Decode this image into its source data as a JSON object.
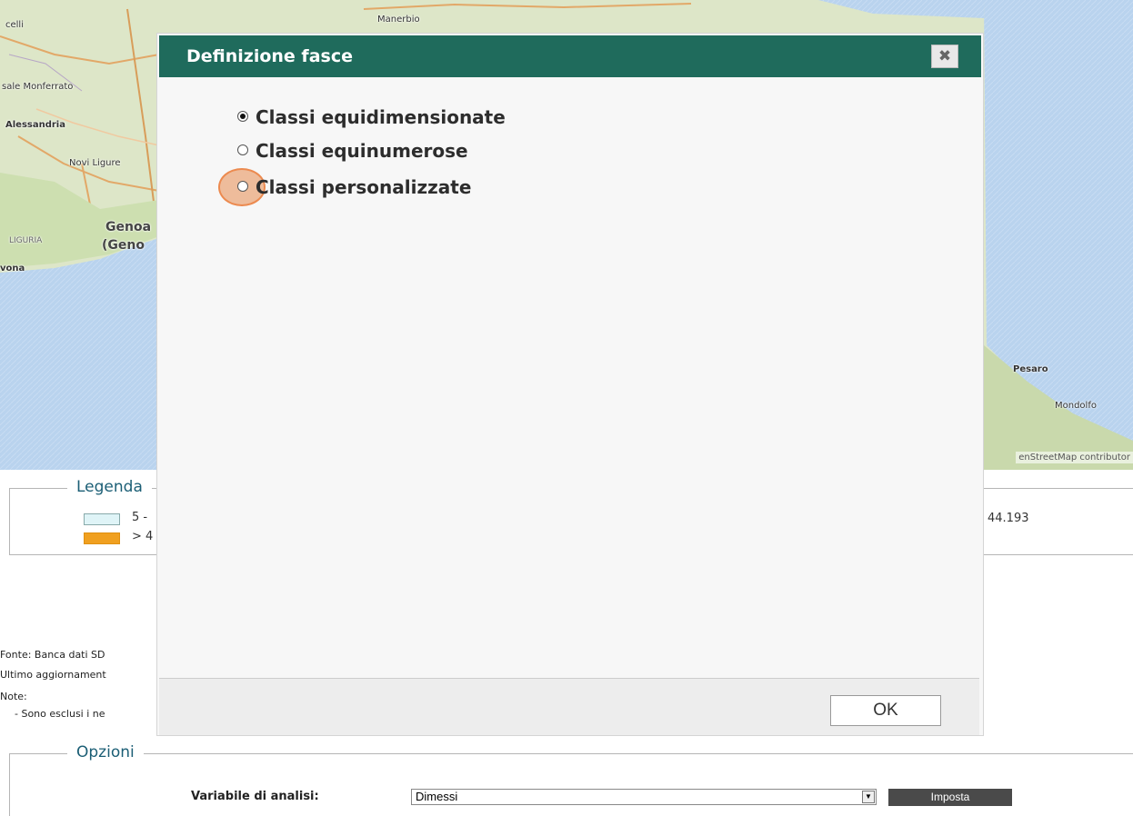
{
  "map": {
    "labels": {
      "celli": "celli",
      "manerbio": "Manerbio",
      "casale_monferrato": "sale Monferrato",
      "alessandria": "Alessandria",
      "novi_ligure": "Novi Ligure",
      "genova": "Genoa",
      "genova2": "(Geno",
      "liguria": "LIGURIA",
      "savona": "vona",
      "pesaro": "Pesaro",
      "mondolfo": "Mondolfo"
    },
    "attribution": "enStreetMap contributor"
  },
  "legend": {
    "title": "Legenda",
    "items": [
      {
        "color": "#dff4f7",
        "label": "5 -"
      },
      {
        "color": "#f0a020",
        "label": "> 4"
      }
    ],
    "right_value": "44.193"
  },
  "notes": {
    "fonte": "Fonte: Banca dati SD",
    "ultimo": "Ultimo aggiornament",
    "note": "Note:",
    "esclusi": "- Sono esclusi i ne"
  },
  "options": {
    "title": "Opzioni",
    "variabile_label": "Variabile di analisi:",
    "variabile_value": "Dimessi",
    "imposta_label": "Imposta"
  },
  "dialog": {
    "title": "Definizione fasce",
    "close_symbol": "✖",
    "options": [
      {
        "label": "Classi equidimensionate",
        "checked": true
      },
      {
        "label": "Classi equinumerose",
        "checked": false
      },
      {
        "label": "Classi personalizzate",
        "checked": false
      }
    ],
    "ok_label": "OK"
  }
}
